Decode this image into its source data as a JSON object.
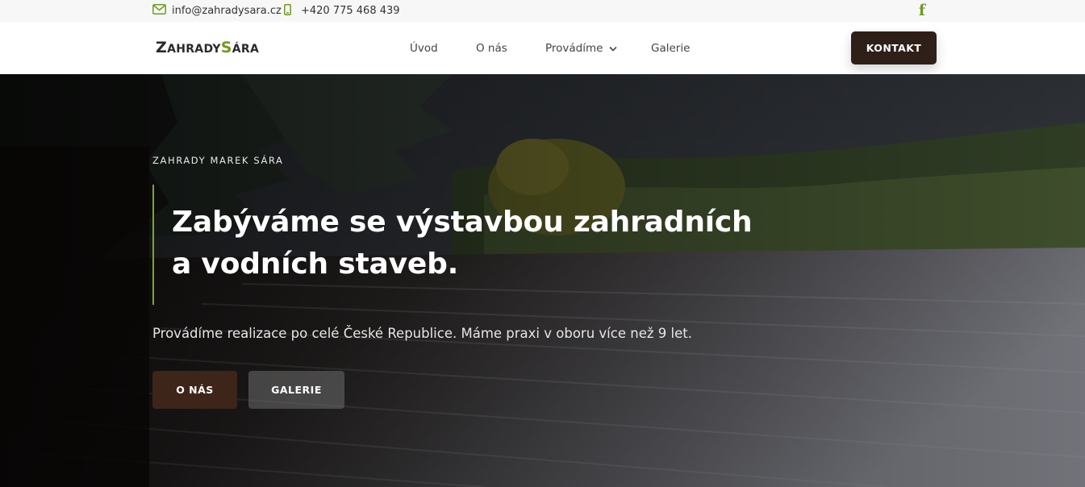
{
  "topbar": {
    "email": "info@zahradysara.cz",
    "phone": "+420 775 468 439",
    "facebook_glyph": "f"
  },
  "header": {
    "logo": {
      "part1_big": "Z",
      "part1_rest": "AHRADY",
      "part2_big": "S",
      "part2_rest": "ÁRA"
    },
    "nav": [
      {
        "label": "Úvod"
      },
      {
        "label": "O nás"
      },
      {
        "label": "Provádíme",
        "has_dropdown": true
      },
      {
        "label": "Galerie"
      }
    ],
    "cta_label": "KONTAKT"
  },
  "hero": {
    "tagline": "ZAHRADY MAREK SÁRA",
    "headline_line1": "Zabýváme se výstavbou zahradních",
    "headline_line2": "a vodních staveb.",
    "subtitle": "Provádíme realizace po celé České Republice. Máme praxi v oboru více než 9 let.",
    "button_about": "O NÁS",
    "button_gallery": "GALERIE"
  },
  "colors": {
    "accent_green": "#6d9a1f",
    "dark_brown": "#2e1f18",
    "button_brown": "#3d2519"
  },
  "icons": [
    "mail-icon",
    "phone-icon",
    "facebook-icon",
    "chevron-down-icon"
  ]
}
